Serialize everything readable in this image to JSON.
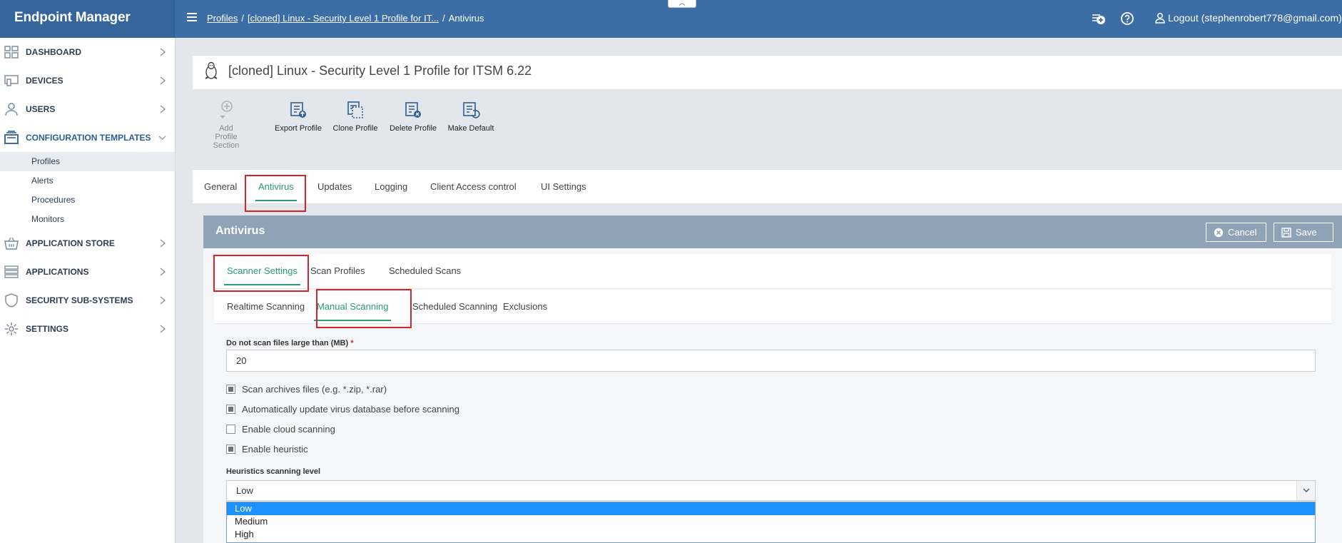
{
  "app": {
    "brand": "Endpoint Manager"
  },
  "breadcrumb": {
    "items": [
      "Profiles",
      "[cloned] Linux - Security Level 1 Profile for IT...",
      "Antivirus"
    ],
    "separator": "/"
  },
  "header": {
    "collapse_glyph": "︿",
    "logout_label": "Logout (stephenrobert778@gmail.com)"
  },
  "sidebar": {
    "items": [
      {
        "label": "DASHBOARD",
        "icon": "dashboard-icon"
      },
      {
        "label": "DEVICES",
        "icon": "devices-icon"
      },
      {
        "label": "USERS",
        "icon": "user-icon"
      },
      {
        "label": "CONFIGURATION TEMPLATES",
        "icon": "templates-icon",
        "expanded": true
      },
      {
        "label": "APPLICATION STORE",
        "icon": "basket-icon"
      },
      {
        "label": "APPLICATIONS",
        "icon": "applications-icon"
      },
      {
        "label": "SECURITY SUB-SYSTEMS",
        "icon": "shield-icon"
      },
      {
        "label": "SETTINGS",
        "icon": "gear-icon"
      }
    ],
    "sub_items": [
      "Profiles",
      "Alerts",
      "Procedures",
      "Monitors"
    ],
    "active_sub_item": "Profiles"
  },
  "profile": {
    "title": "[cloned] Linux - Security Level 1 Profile for ITSM 6.22"
  },
  "toolbar": {
    "add_section_line1": "Add Profile",
    "add_section_line2": "Section",
    "export_label": "Export Profile",
    "clone_label": "Clone Profile",
    "delete_label": "Delete Profile",
    "default_label": "Make Default"
  },
  "tabs": [
    "General",
    "Antivirus",
    "Updates",
    "Logging",
    "Client Access control",
    "UI Settings"
  ],
  "active_tab": "Antivirus",
  "panel": {
    "title": "Antivirus",
    "cancel_label": "Cancel",
    "save_label": "Save"
  },
  "subtabs": [
    "Scanner Settings",
    "Scan Profiles",
    "Scheduled Scans"
  ],
  "active_subtab": "Scanner Settings",
  "scan_tabs": [
    "Realtime Scanning",
    "Manual Scanning",
    "Scheduled Scanning",
    "Exclusions"
  ],
  "active_scan_tab": "Manual Scanning",
  "form": {
    "max_size_label": "Do not scan files large than (MB)",
    "required_mark": "*",
    "max_size_value": "20",
    "checkboxes": [
      {
        "label": "Scan archives files (e.g. *.zip, *.rar)",
        "checked": true
      },
      {
        "label": "Automatically update virus database before scanning",
        "checked": true
      },
      {
        "label": "Enable cloud scanning",
        "checked": false
      },
      {
        "label": "Enable heuristic",
        "checked": true
      }
    ],
    "heuristics_label": "Heuristics scanning level",
    "heuristics_value": "Low",
    "heuristics_options": [
      "Low",
      "Medium",
      "High"
    ]
  },
  "colors": {
    "header": "#3c6ea5",
    "accent_green": "#2a9a78",
    "highlight_red": "#d8232a",
    "panel_head": "#8ea3b6",
    "option_selected": "#1e90ff"
  }
}
